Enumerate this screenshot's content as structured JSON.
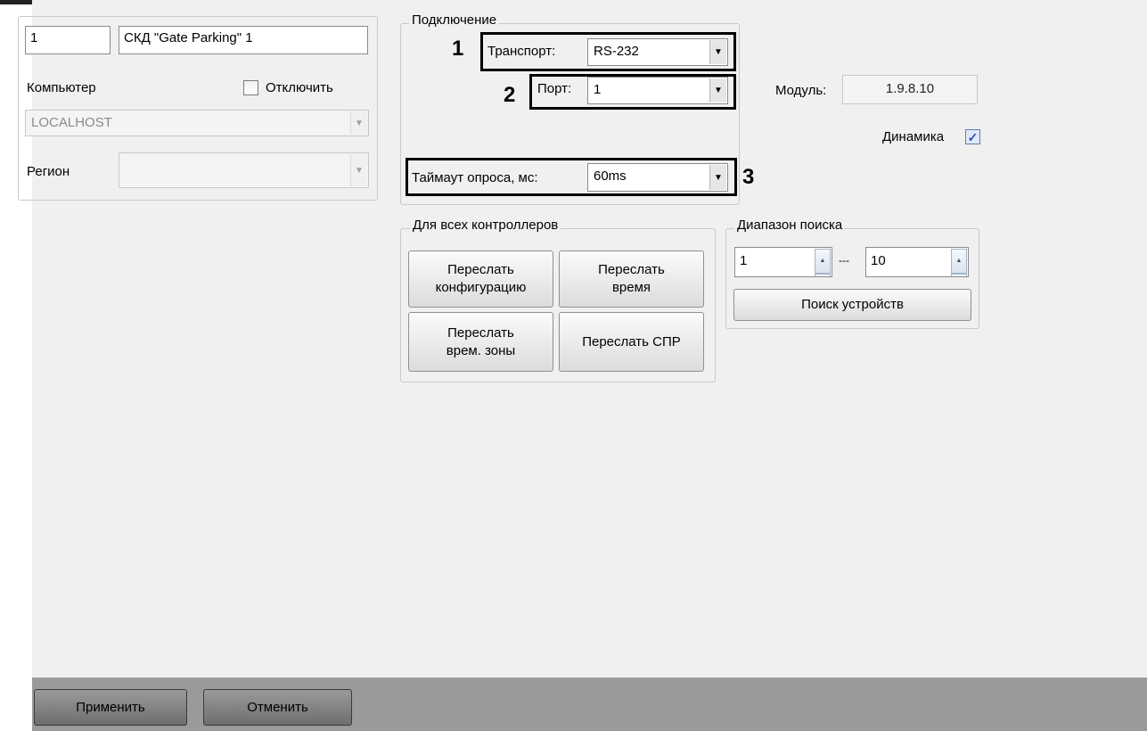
{
  "device": {
    "id": "1",
    "name": "СКД \"Gate Parking\" 1",
    "computer_label": "Компьютер",
    "disable_label": "Отключить",
    "computer_value": "LOCALHOST",
    "region_label": "Регион",
    "region_value": ""
  },
  "connection": {
    "group_title": "Подключение",
    "transport_label": "Транспорт:",
    "transport_value": "RS-232",
    "port_label": "Порт:",
    "port_value": "1",
    "timeout_label": "Таймаут опроса, мс:",
    "timeout_value": "60ms"
  },
  "annotations": {
    "n1": "1",
    "n2": "2",
    "n3": "3"
  },
  "module": {
    "label": "Модуль:",
    "value": "1.9.8.10",
    "dynamics_label": "Динамика",
    "dynamics_checked": true
  },
  "all_controllers": {
    "group_title": "Для всех контроллеров",
    "send_config_l1": "Переслать",
    "send_config_l2": "конфигурацию",
    "send_time_l1": "Переслать",
    "send_time_l2": "время",
    "send_zones_l1": "Переслать",
    "send_zones_l2": "врем. зоны",
    "send_spr": "Переслать СПР"
  },
  "search_range": {
    "group_title": "Диапазон поиска",
    "from": "1",
    "separator": "---",
    "to": "10",
    "search_button": "Поиск устройств"
  },
  "footer": {
    "apply": "Применить",
    "cancel": "Отменить"
  },
  "colors": {
    "panel": "#f0f0f0",
    "footer": "#9a9a9a",
    "highlight": "#000000"
  }
}
